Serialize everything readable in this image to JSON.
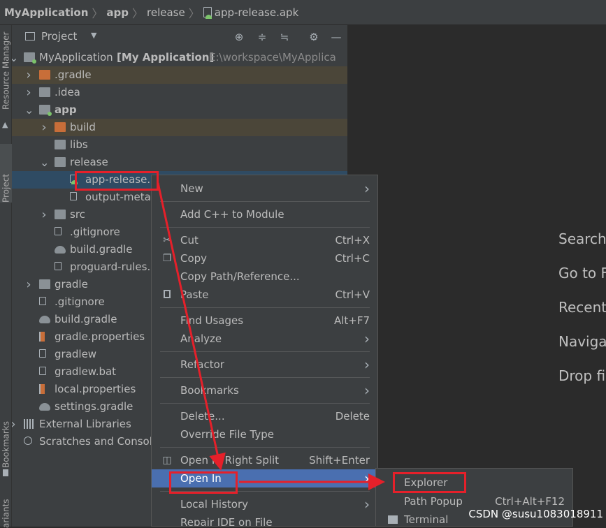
{
  "breadcrumb": [
    "MyApplication",
    "app",
    "release",
    "app-release.apk"
  ],
  "side_tabs": {
    "resource_manager": "Resource Manager",
    "project": "Project",
    "bookmarks": "Bookmarks",
    "variants": "ariants"
  },
  "panel": {
    "title": "Project",
    "icons": [
      "target-icon",
      "expand-all-icon",
      "collapse-all-icon",
      "gear-icon",
      "minimize-icon"
    ]
  },
  "tree": [
    {
      "name": "MyApplication",
      "bold_suffix": "[My Application]",
      "path": "E:\\workspace\\MyApplica",
      "arrow": "down",
      "icon": "module-folder"
    },
    {
      "name": ".gradle",
      "arrow": "right",
      "icon": "folder-orange",
      "highlight": "tan"
    },
    {
      "name": ".idea",
      "arrow": "right",
      "icon": "folder"
    },
    {
      "name": "app",
      "arrow": "down",
      "icon": "module-folder"
    },
    {
      "name": "build",
      "arrow": "right",
      "icon": "folder-orange",
      "highlight": "tan"
    },
    {
      "name": "libs",
      "arrow": "",
      "icon": "folder"
    },
    {
      "name": "release",
      "arrow": "down",
      "icon": "folder"
    },
    {
      "name": "app-release.apk",
      "arrow": "",
      "icon": "apk-file",
      "highlight": "selected"
    },
    {
      "name": "output-metadata.json",
      "arrow": "",
      "icon": "json-file"
    },
    {
      "name": "src",
      "arrow": "right",
      "icon": "folder"
    },
    {
      "name": ".gitignore",
      "arrow": "",
      "icon": "gitignore-file"
    },
    {
      "name": "build.gradle",
      "arrow": "",
      "icon": "gradle-file"
    },
    {
      "name": "proguard-rules.pro",
      "arrow": "",
      "icon": "text-file"
    },
    {
      "name": "gradle",
      "arrow": "right",
      "icon": "folder"
    },
    {
      "name": ".gitignore",
      "arrow": "",
      "icon": "gitignore-file"
    },
    {
      "name": "build.gradle",
      "arrow": "",
      "icon": "gradle-file"
    },
    {
      "name": "gradle.properties",
      "arrow": "",
      "icon": "properties-file"
    },
    {
      "name": "gradlew",
      "arrow": "",
      "icon": "terminal-file"
    },
    {
      "name": "gradlew.bat",
      "arrow": "",
      "icon": "text-file"
    },
    {
      "name": "local.properties",
      "arrow": "",
      "icon": "properties-file"
    },
    {
      "name": "settings.gradle",
      "arrow": "",
      "icon": "gradle-file"
    },
    {
      "name": "External Libraries",
      "arrow": "right",
      "icon": "libraries"
    },
    {
      "name": "Scratches and Consoles",
      "arrow": "",
      "icon": "scratches"
    }
  ],
  "editor_hints": [
    "Search",
    "Go to F",
    "Recent",
    "Naviga",
    "Drop fi"
  ],
  "context_menu": [
    {
      "label": "New",
      "submenu": true
    },
    {
      "separator": true
    },
    {
      "label": "Add C++ to Module"
    },
    {
      "separator": true
    },
    {
      "label": "Cut",
      "shortcut": "Ctrl+X",
      "icon": "scissors-icon"
    },
    {
      "label": "Copy",
      "shortcut": "Ctrl+C",
      "icon": "copy-icon"
    },
    {
      "label": "Copy Path/Reference..."
    },
    {
      "label": "Paste",
      "shortcut": "Ctrl+V",
      "icon": "clipboard-icon"
    },
    {
      "separator": true
    },
    {
      "label": "Find Usages",
      "shortcut": "Alt+F7"
    },
    {
      "label": "Analyze",
      "submenu": true
    },
    {
      "separator": true
    },
    {
      "label": "Refactor",
      "submenu": true
    },
    {
      "separator": true
    },
    {
      "label": "Bookmarks",
      "submenu": true
    },
    {
      "separator": true
    },
    {
      "label": "Delete...",
      "shortcut": "Delete"
    },
    {
      "label": "Override File Type"
    },
    {
      "separator": true
    },
    {
      "label": "Open In Right Split",
      "shortcut": "Shift+Enter",
      "icon": "split-icon"
    },
    {
      "label": "Open In",
      "submenu": true,
      "active": true
    },
    {
      "separator": true
    },
    {
      "label": "Local History",
      "submenu": true
    },
    {
      "label": "Repair IDE on File"
    }
  ],
  "open_in_submenu": [
    {
      "label": "Explorer"
    },
    {
      "label": "Path Popup",
      "shortcut": "Ctrl+Alt+F12"
    },
    {
      "label": "Terminal",
      "icon": "terminal-icon"
    }
  ],
  "watermark": "CSDN @susu1083018911",
  "colors": {
    "annotation": "#e5202a",
    "selection": "#4a6fb0",
    "tree_selected": "#2f4b63",
    "excluded_folder": "#c86e39"
  }
}
